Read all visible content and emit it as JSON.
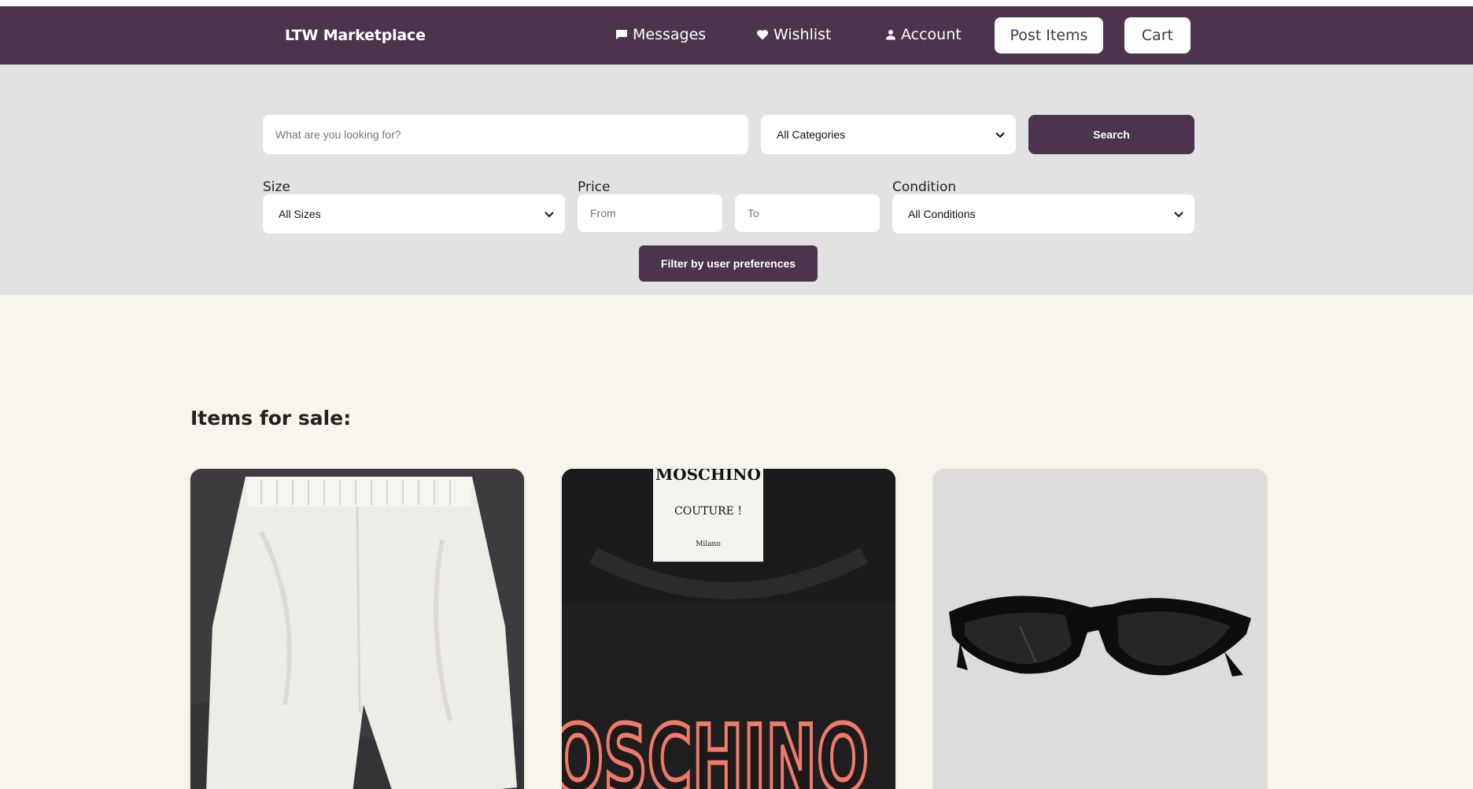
{
  "nav": {
    "brand": "LTW Marketplace",
    "messages": "Messages",
    "wishlist": "Wishlist",
    "account": "Account",
    "post_items": "Post Items",
    "cart": "Cart"
  },
  "search": {
    "placeholder": "What are you looking for?",
    "category_selected": "All Categories",
    "button": "Search"
  },
  "filters": {
    "size_label": "Size",
    "size_selected": "All Sizes",
    "price_label": "Price",
    "price_from_placeholder": "From",
    "price_to_placeholder": "To",
    "condition_label": "Condition",
    "condition_selected": "All Conditions",
    "preferences_button": "Filter by user preferences"
  },
  "listing": {
    "title": "Items for sale:",
    "items": [
      {
        "image": "white-shorts-photo"
      },
      {
        "image": "moschino-tshirt-photo",
        "label_lines": [
          "MOSCHINO",
          "COUTURE !",
          "Milano"
        ],
        "print_text": "MOSCHINO"
      },
      {
        "image": "black-sunglasses-photo"
      }
    ]
  },
  "colors": {
    "primary": "#4c344c",
    "filter_bg": "#e2e2e2",
    "page_bg": "#f8f5ec"
  }
}
